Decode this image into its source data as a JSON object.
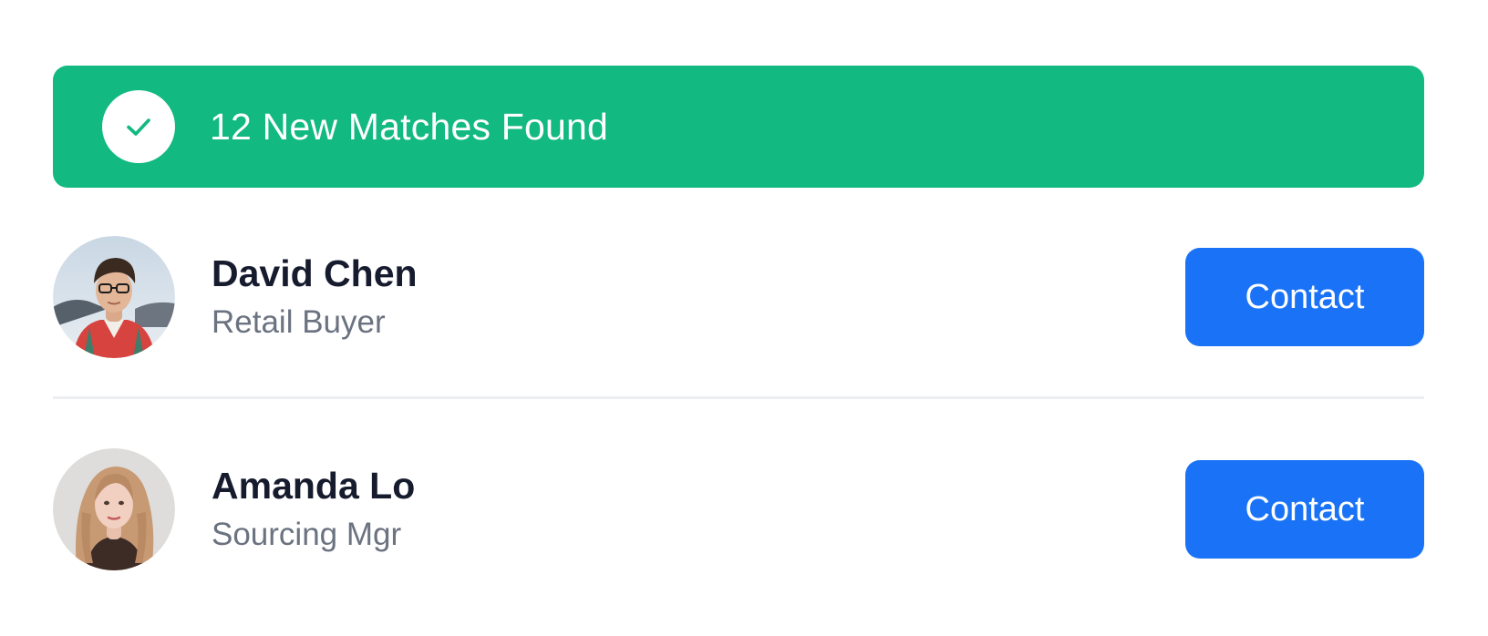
{
  "banner": {
    "icon": "check-icon",
    "text": "12 New Matches Found",
    "color": "#12b981"
  },
  "matches": [
    {
      "name": "David Chen",
      "role": "Retail Buyer",
      "avatar": "avatar-photo-man",
      "button_label": "Contact"
    },
    {
      "name": "Amanda Lo",
      "role": "Sourcing Mgr",
      "avatar": "avatar-photo-woman",
      "button_label": "Contact"
    }
  ],
  "colors": {
    "accent_button": "#1a73f7",
    "name_text": "#161b2e",
    "role_text": "#6b7280",
    "divider": "#eceef2"
  }
}
